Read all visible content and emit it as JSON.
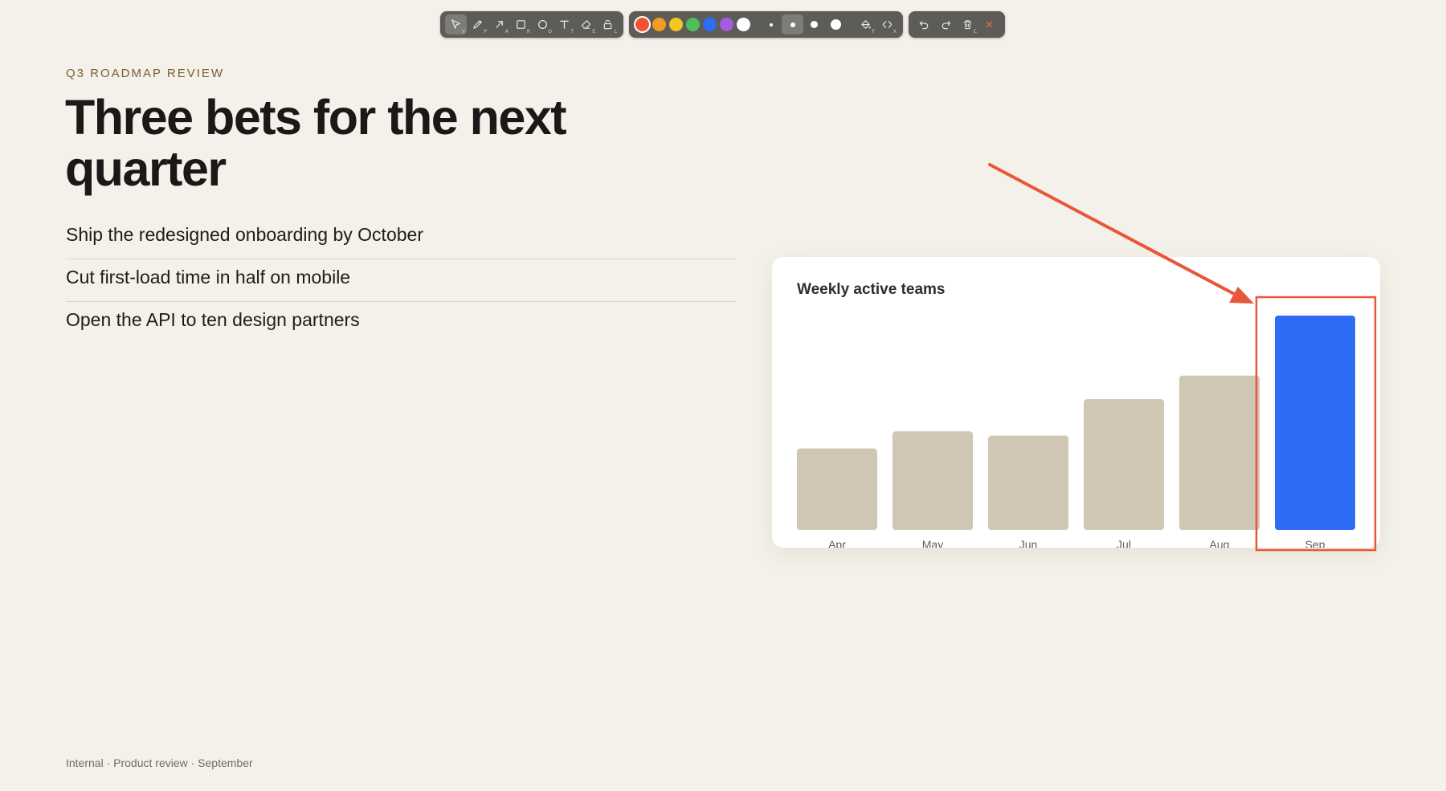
{
  "toolbar": {
    "tools": [
      {
        "name": "select-tool",
        "icon": "cursor-icon",
        "key": "V",
        "active": true
      },
      {
        "name": "pen-tool",
        "icon": "pencil-icon",
        "key": "P",
        "active": false
      },
      {
        "name": "arrow-tool",
        "icon": "arrow-icon",
        "key": "A",
        "active": false
      },
      {
        "name": "rectangle-tool",
        "icon": "rectangle-icon",
        "key": "R",
        "active": false
      },
      {
        "name": "ellipse-tool",
        "icon": "ellipse-icon",
        "key": "O",
        "active": false
      },
      {
        "name": "text-tool",
        "icon": "text-icon",
        "key": "T",
        "active": false
      },
      {
        "name": "eraser-tool",
        "icon": "eraser-icon",
        "key": "E",
        "active": false
      },
      {
        "name": "lock-tool",
        "icon": "lock-icon",
        "key": "L",
        "active": false
      }
    ],
    "colors": [
      "#f0532f",
      "#f39c22",
      "#f2c81e",
      "#4cbf5a",
      "#2f6cf6",
      "#a35be0",
      "#ffffff"
    ],
    "selected_color": "#f0532f",
    "sizes": [
      "xs",
      "s",
      "m",
      "l"
    ],
    "selected_size": "s",
    "extras": [
      {
        "name": "fill-tool",
        "icon": "paint-bucket-icon",
        "key": "F"
      },
      {
        "name": "embed-tool",
        "icon": "code-icon",
        "key": "X"
      }
    ],
    "history": [
      {
        "name": "undo-button",
        "icon": "undo-icon"
      },
      {
        "name": "redo-button",
        "icon": "redo-icon"
      },
      {
        "name": "clear-button",
        "icon": "trash-icon",
        "key": "C"
      },
      {
        "name": "close-button",
        "icon": "close-icon"
      }
    ]
  },
  "slide": {
    "eyebrow": "Q3 ROADMAP REVIEW",
    "title": "Three bets for the next quarter",
    "bullets": [
      "Ship the redesigned onboarding by October",
      "Cut first-load time in half on mobile",
      "Open the API to ten design partners"
    ],
    "footer": "Internal · Product review · September"
  },
  "chart_data": {
    "type": "bar",
    "title": "Weekly active teams",
    "categories": [
      "Apr",
      "May",
      "Jun",
      "Jul",
      "Aug",
      "Sep"
    ],
    "values": [
      38,
      46,
      44,
      61,
      72,
      100
    ],
    "highlight_index": 5,
    "ylim": [
      0,
      100
    ],
    "grid": false,
    "colors": {
      "bar": "#cfc6b3",
      "highlight": "#2f6cf6"
    }
  },
  "annotations": {
    "color": "#e8573a",
    "items": [
      "arrow",
      "rectangle"
    ]
  }
}
